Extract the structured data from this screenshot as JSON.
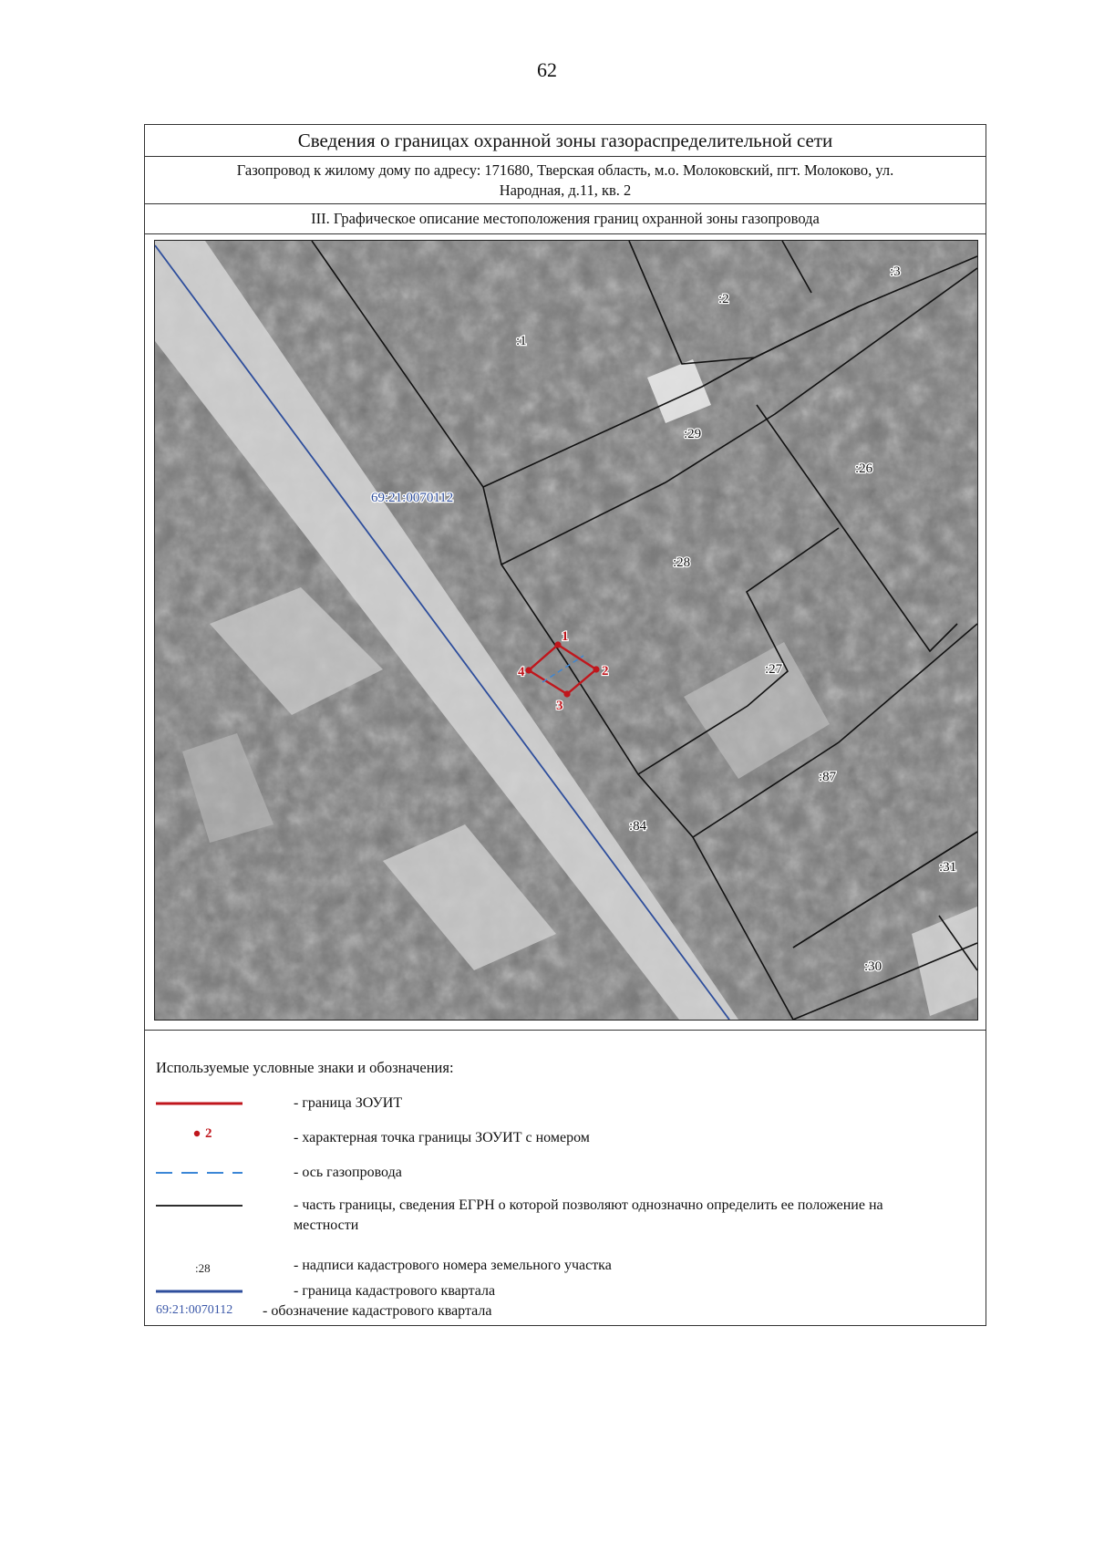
{
  "page_number": "62",
  "header": {
    "title": "Сведения о границах охранной зоны газораспределительной сети",
    "object_line1": "Газопровод к жилому дому по адресу: 171680, Тверская область, м.о. Молоковский, пгт. Молоково, ул.",
    "object_line2": "Народная, д.11, кв. 2",
    "section": "III. Графическое описание местоположения границ охранной зоны газопровода"
  },
  "map": {
    "quarter_label": "69:21:0070112",
    "parcel_labels": [
      ":1",
      ":2",
      ":3",
      ":29",
      ":26",
      ":28",
      ":27",
      ":87",
      ":84",
      ":31",
      ":30"
    ],
    "point_labels": [
      "1",
      "2",
      "3",
      "4"
    ],
    "colors": {
      "zone_boundary": "#c0161c",
      "pipeline_axis": "#3b86d6",
      "parcel_boundary": "#111111",
      "quarter_boundary": "#2e4e9c"
    }
  },
  "legend": {
    "title": "Используемые условные знаки и обозначения:",
    "items": [
      {
        "symbol": "red-line",
        "text": "- граница ЗОУИТ"
      },
      {
        "symbol": "red-point",
        "sample": "2",
        "text": "- характерная точка границы ЗОУИТ с номером"
      },
      {
        "symbol": "blue-dashed-line",
        "text": "- ось газопровода"
      },
      {
        "symbol": "black-line",
        "text": "- часть границы, сведения ЕГРН о которой позволяют однозначно определить ее положение на местности"
      },
      {
        "symbol": "label-sample",
        "sample": ":28",
        "text": "- надписи кадастрового номера земельного участка"
      },
      {
        "symbol": "blue-line",
        "text": "- граница кадастрового квартала"
      }
    ],
    "quarter_sample": "69:21:0070112",
    "quarter_text": "- обозначение кадастрового квартала"
  }
}
